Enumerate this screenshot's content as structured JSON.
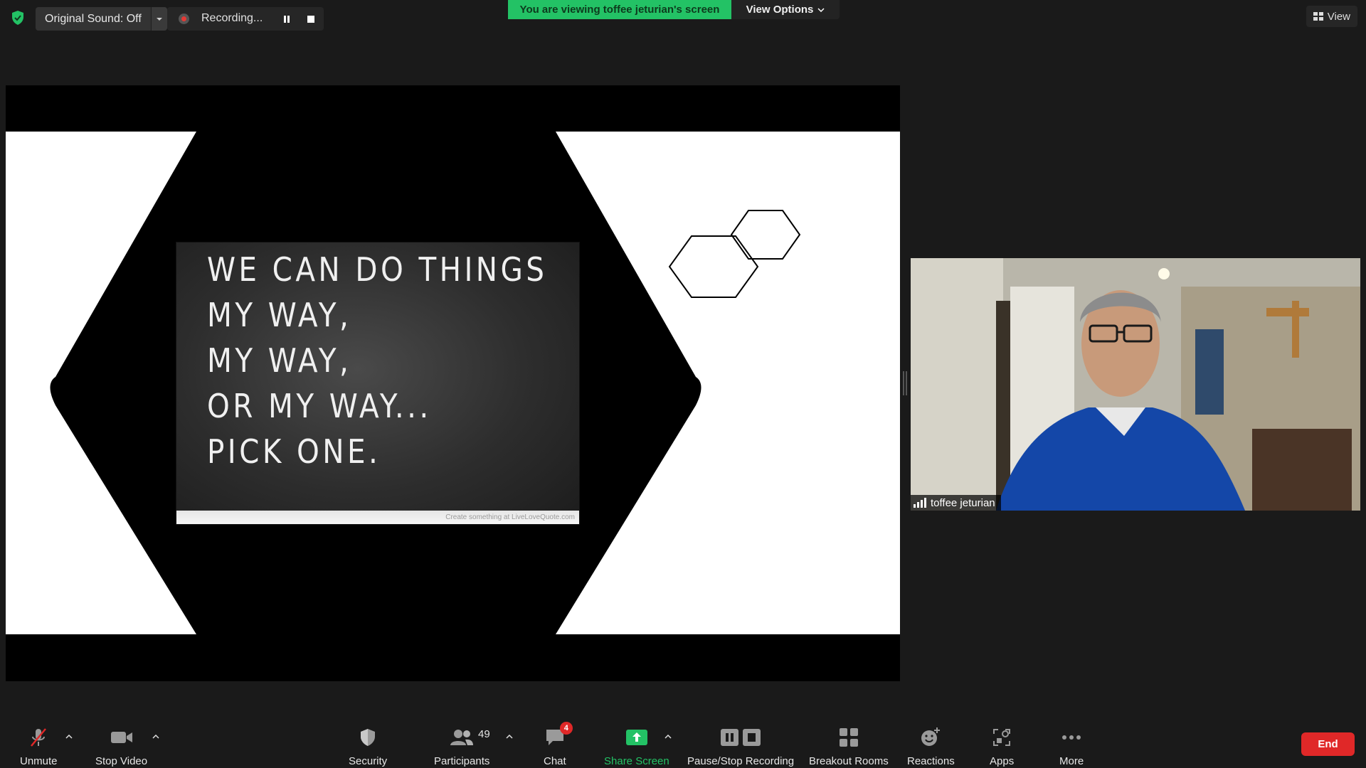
{
  "top_bar": {
    "original_sound": "Original Sound: Off",
    "recording_label": "Recording...",
    "viewing_banner": "You are viewing toffee jeturian's screen",
    "view_options": "View Options",
    "view_label": "View"
  },
  "shared_screen": {
    "board_lines": [
      "WE CAN DO THINGS",
      "MY WAY,",
      "MY WAY,",
      "OR MY WAY...",
      "PICK ONE."
    ],
    "board_footer": "Create something at LiveLoveQuote.com"
  },
  "participant": {
    "name": "toffee jeturian"
  },
  "toolbar": {
    "unmute": "Unmute",
    "stop_video": "Stop Video",
    "security": "Security",
    "participants": "Participants",
    "participants_count": "49",
    "chat": "Chat",
    "chat_badge": "4",
    "share_screen": "Share Screen",
    "pause_stop_recording": "Pause/Stop Recording",
    "breakout_rooms": "Breakout Rooms",
    "reactions": "Reactions",
    "apps": "Apps",
    "more": "More",
    "end": "End"
  },
  "colors": {
    "accent_green": "#23c265",
    "end_red": "#e02828",
    "background": "#1a1a1a"
  }
}
